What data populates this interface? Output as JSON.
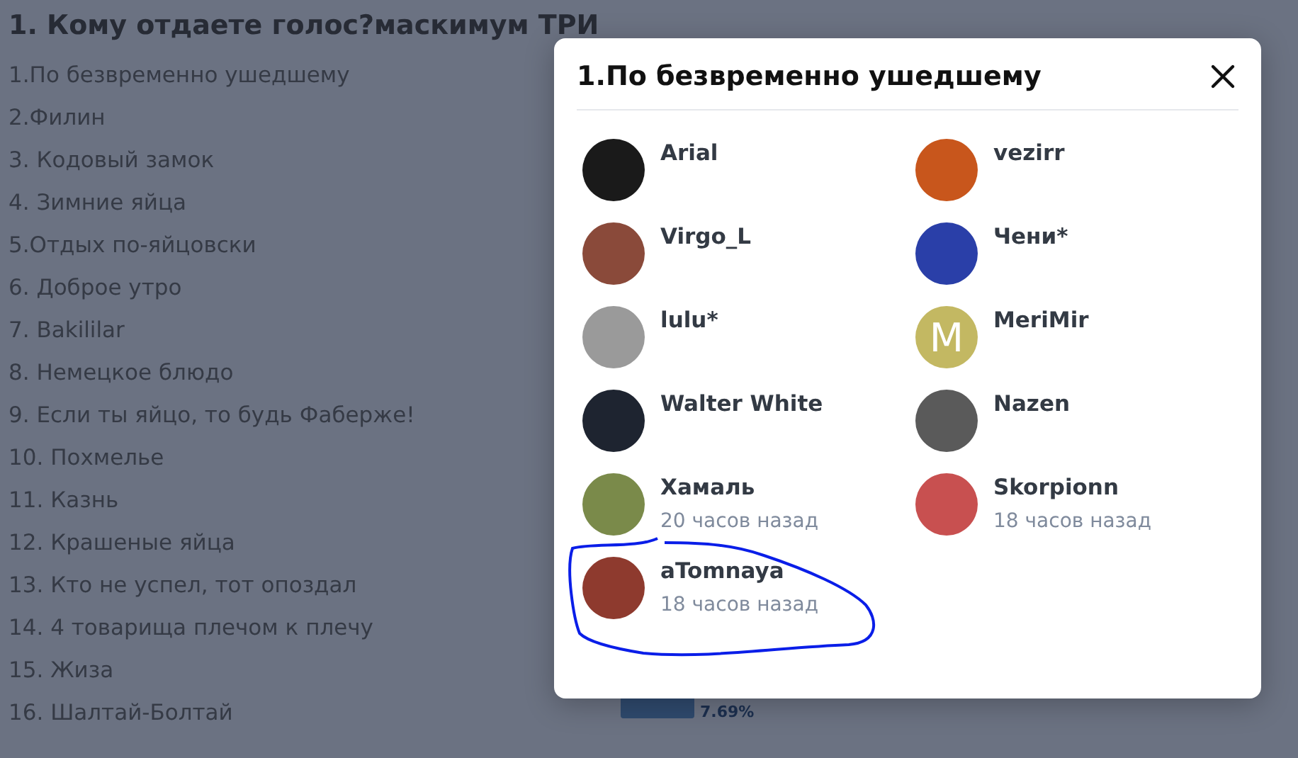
{
  "poll": {
    "question": "1. Кому отдаете голос?маскимум ТРИ",
    "options": [
      "1.По безвременно ушедшему",
      "2.Филин",
      "3. Кодовый замок",
      "4. Зимние яйца",
      "5.Отдых по-яйцовски",
      "6. Доброе утро",
      "7. Bakililar",
      "8. Немецкое блюдо",
      "9. Если ты яйцо, то будь Фаберже!",
      "10. Похмелье",
      "11. Казнь",
      "12. Крашеные яйца",
      "13. Кто не успел, тот опоздал",
      "14. 4 товарища плечом к плечу",
      "15. Жиза",
      "16. Шалтай-Болтай"
    ],
    "result_percent": "7.69%"
  },
  "dialog": {
    "title": "1.По безвременно ушедшему",
    "voters": [
      {
        "name": "Arial",
        "kind": "photo",
        "color": "#1a1a1a"
      },
      {
        "name": "vezirr",
        "kind": "photo",
        "color": "#c8561c"
      },
      {
        "name": "Virgo_L",
        "kind": "photo",
        "color": "#8a4a3a"
      },
      {
        "name": "Чени*",
        "kind": "photo",
        "color": "#2a3fa8"
      },
      {
        "name": "lulu*",
        "kind": "photo",
        "color": "#9a9a9a"
      },
      {
        "name": "MeriMir",
        "kind": "letter",
        "letter": "M",
        "color": "#c3b862"
      },
      {
        "name": "Walter White",
        "kind": "photo",
        "color": "#1e2430"
      },
      {
        "name": "Nazen",
        "kind": "photo",
        "color": "#5a5a5a"
      },
      {
        "name": "Хамаль",
        "kind": "photo",
        "color": "#7a8a4a",
        "time": "20 часов назад"
      },
      {
        "name": "Skorpionn",
        "kind": "photo",
        "color": "#c85050",
        "time": "18 часов назад"
      },
      {
        "name": "aTomnaya",
        "kind": "photo",
        "color": "#8e3a2e",
        "time": "18 часов назад",
        "circled": true
      }
    ]
  }
}
